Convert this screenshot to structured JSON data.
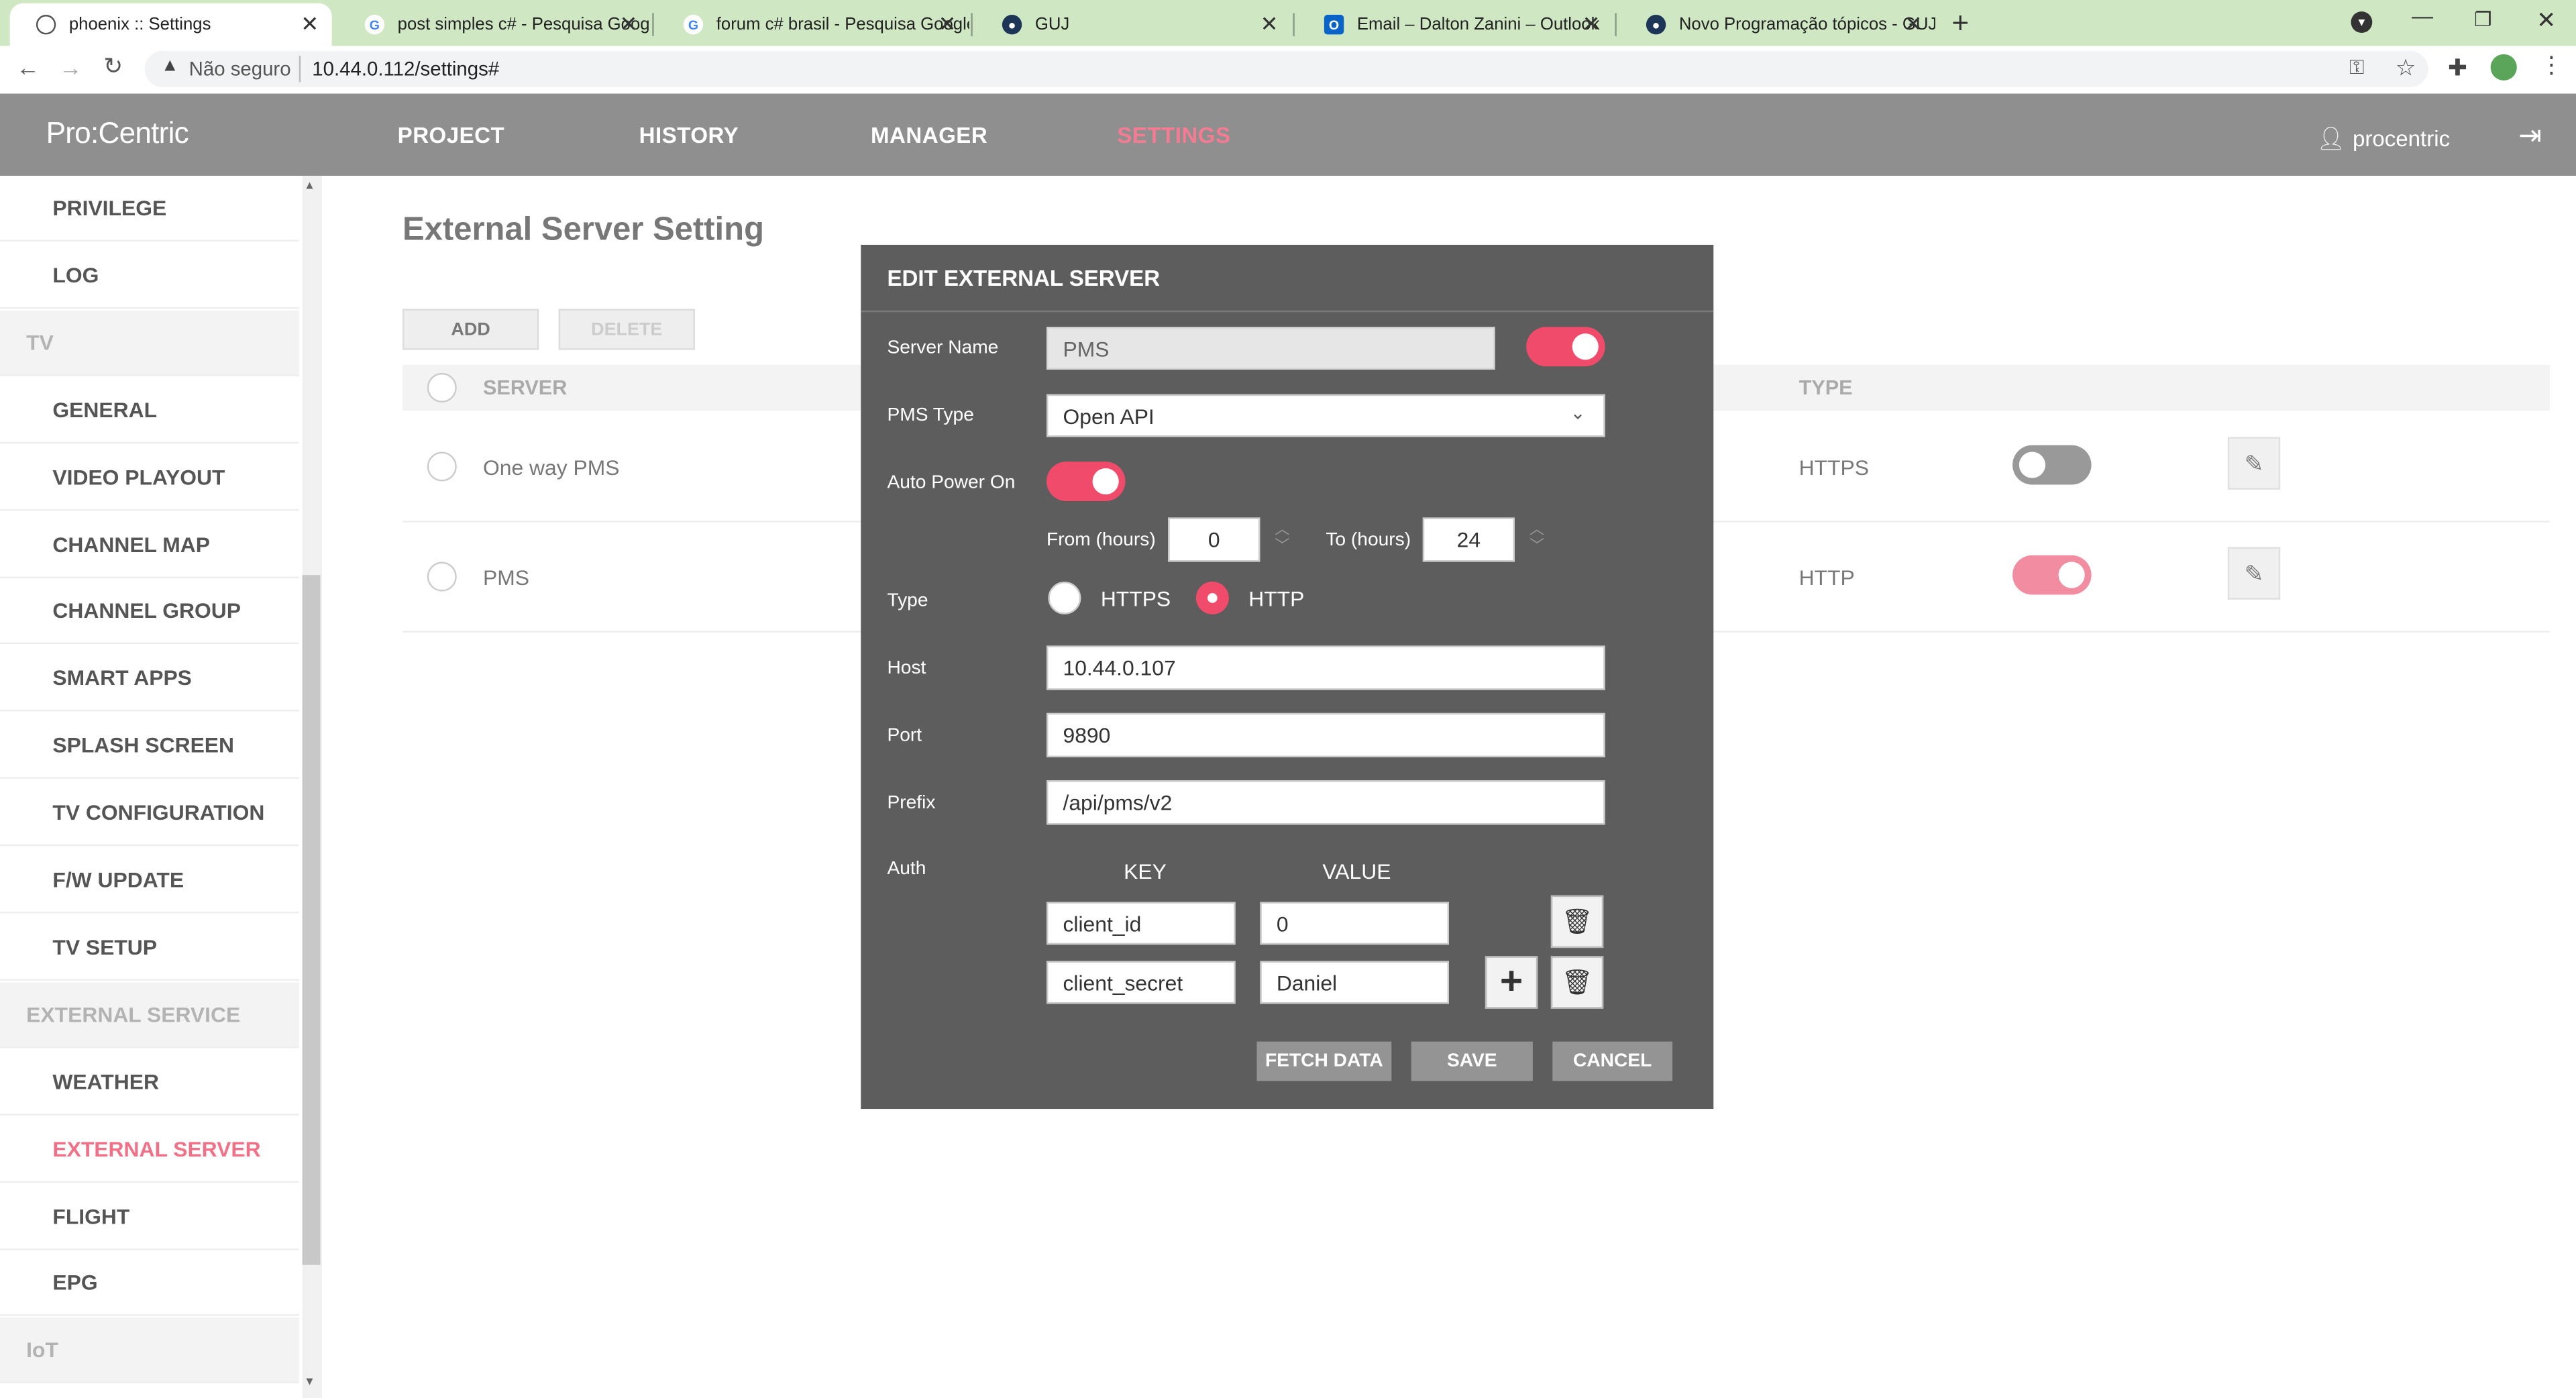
{
  "browser": {
    "tabs": [
      {
        "title": "phoenix :: Settings",
        "active": true
      },
      {
        "title": "post simples c# - Pesquisa Google"
      },
      {
        "title": "forum c# brasil - Pesquisa Google"
      },
      {
        "title": "GUJ"
      },
      {
        "title": "Email – Dalton Zanini – Outlook"
      },
      {
        "title": "Novo Programação tópicos - GUJ"
      }
    ],
    "security_label": "Não seguro",
    "url": "10.44.0.112/settings#"
  },
  "app": {
    "logo": "Pro:Centric",
    "nav": [
      "PROJECT",
      "HISTORY",
      "MANAGER",
      "SETTINGS"
    ],
    "active_nav": "SETTINGS",
    "user": "procentric",
    "accent_color": "#f04b6a"
  },
  "sidebar": {
    "items": [
      {
        "label": "PRIVILEGE",
        "kind": "item"
      },
      {
        "label": "LOG",
        "kind": "item"
      },
      {
        "label": "TV",
        "kind": "group"
      },
      {
        "label": "GENERAL",
        "kind": "item"
      },
      {
        "label": "VIDEO PLAYOUT",
        "kind": "item"
      },
      {
        "label": "CHANNEL MAP",
        "kind": "item"
      },
      {
        "label": "CHANNEL GROUP",
        "kind": "item"
      },
      {
        "label": "SMART APPS",
        "kind": "item"
      },
      {
        "label": "SPLASH SCREEN",
        "kind": "item"
      },
      {
        "label": "TV CONFIGURATION",
        "kind": "item"
      },
      {
        "label": "F/W UPDATE",
        "kind": "item"
      },
      {
        "label": "TV SETUP",
        "kind": "item"
      },
      {
        "label": "EXTERNAL SERVICE",
        "kind": "group"
      },
      {
        "label": "WEATHER",
        "kind": "item"
      },
      {
        "label": "EXTERNAL SERVER",
        "kind": "item",
        "active": true
      },
      {
        "label": "FLIGHT",
        "kind": "item"
      },
      {
        "label": "EPG",
        "kind": "item"
      },
      {
        "label": "IoT",
        "kind": "group"
      }
    ]
  },
  "main": {
    "title": "External Server Setting",
    "add_label": "ADD",
    "delete_label": "DELETE",
    "columns": {
      "server": "SERVER",
      "type": "TYPE"
    },
    "rows": [
      {
        "server": "One way PMS",
        "type": "HTTPS",
        "enabled": false
      },
      {
        "server": "PMS",
        "type": "HTTP",
        "enabled": true
      }
    ]
  },
  "modal": {
    "title": "EDIT EXTERNAL SERVER",
    "server_name_label": "Server Name",
    "server_name_value": "PMS",
    "server_enabled": true,
    "pms_type_label": "PMS Type",
    "pms_type_value": "Open API",
    "auto_power_label": "Auto Power On",
    "auto_power_on": true,
    "from_label": "From (hours)",
    "from_value": "0",
    "to_label": "To (hours)",
    "to_value": "24",
    "type_label": "Type",
    "type_options": [
      "HTTPS",
      "HTTP"
    ],
    "type_selected": "HTTP",
    "host_label": "Host",
    "host_value": "10.44.0.107",
    "port_label": "Port",
    "port_value": "9890",
    "prefix_label": "Prefix",
    "prefix_value": "/api/pms/v2",
    "auth_label": "Auth",
    "key_header": "KEY",
    "value_header": "VALUE",
    "auth": [
      {
        "key": "client_id",
        "value": "0"
      },
      {
        "key": "client_secret",
        "value": "Daniel"
      }
    ],
    "fetch_label": "FETCH DATA",
    "save_label": "SAVE",
    "cancel_label": "CANCEL"
  }
}
